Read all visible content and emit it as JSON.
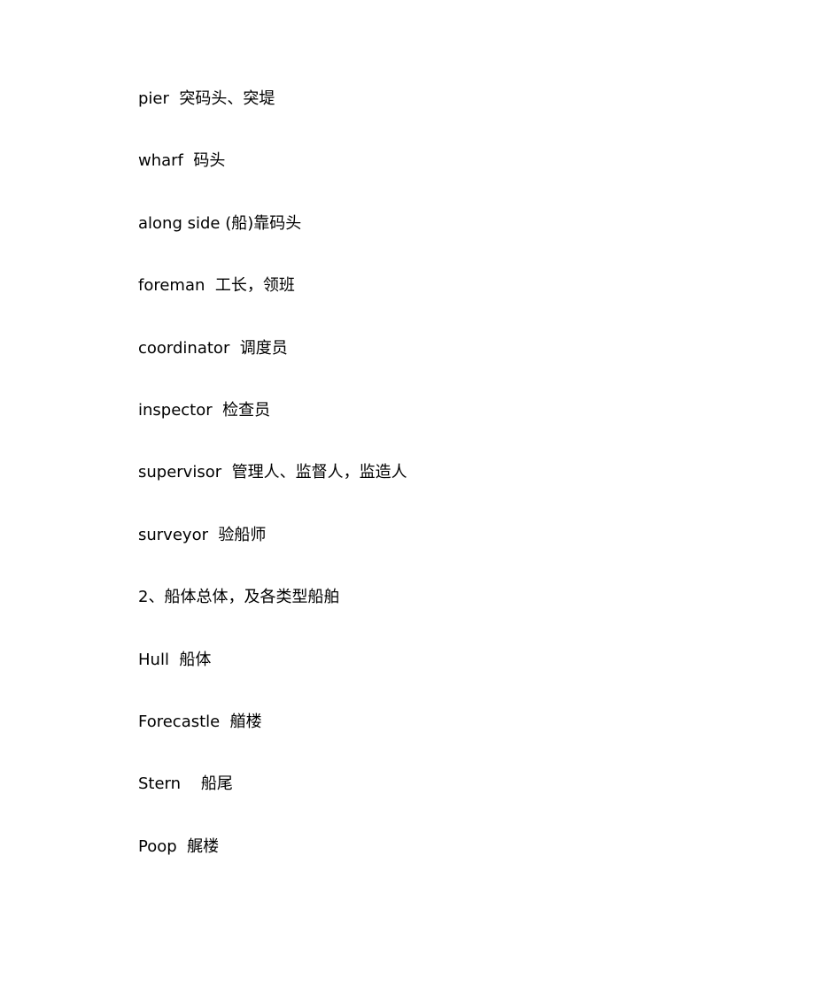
{
  "document": {
    "lines": [
      {
        "text": "pier  突码头、突堤"
      },
      {
        "text": "wharf  码头"
      },
      {
        "text": "along side (船)靠码头"
      },
      {
        "text": "foreman  工长，领班"
      },
      {
        "text": "coordinator  调度员"
      },
      {
        "text": "inspector  检查员"
      },
      {
        "text": "supervisor  管理人、监督人，监造人"
      },
      {
        "text": "surveyor  验船师"
      },
      {
        "text": "2、船体总体，及各类型船舶"
      },
      {
        "text": "Hull  船体"
      },
      {
        "text": "Forecastle  艏楼"
      },
      {
        "text": "Stern    船尾"
      },
      {
        "text": "Poop  艉楼"
      }
    ]
  }
}
